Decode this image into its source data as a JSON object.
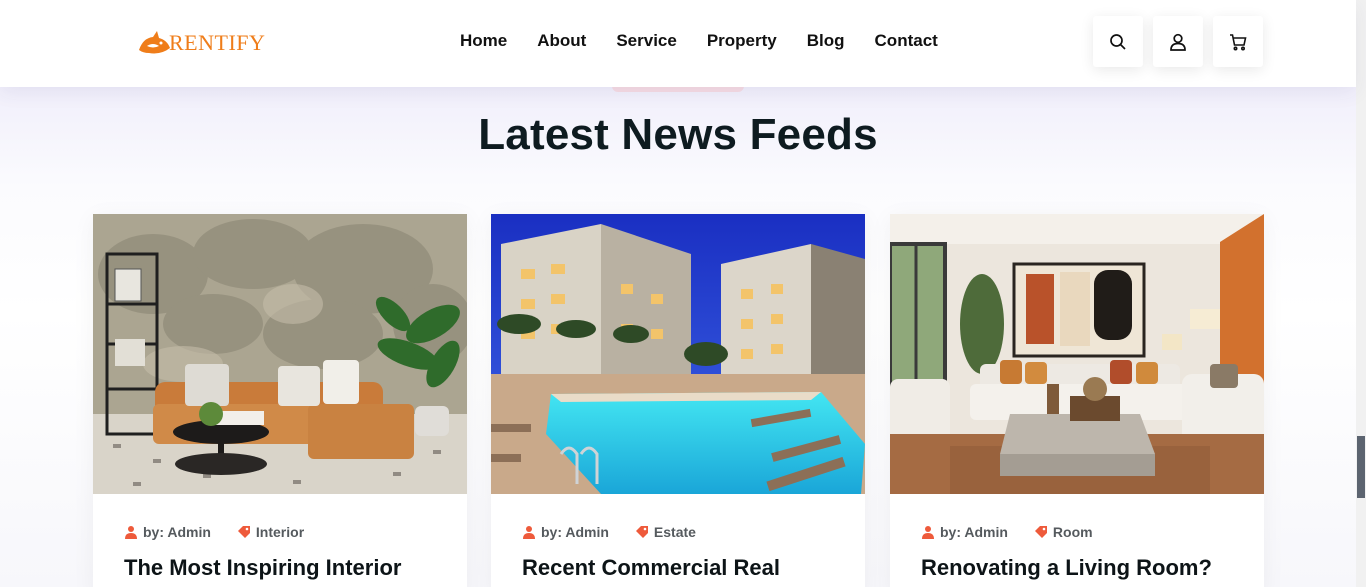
{
  "brand": {
    "name": "RENTIFY",
    "color": "#ef7d1a"
  },
  "nav": {
    "items": [
      {
        "label": "Home"
      },
      {
        "label": "About"
      },
      {
        "label": "Service"
      },
      {
        "label": "Property"
      },
      {
        "label": "Blog"
      },
      {
        "label": "Contact"
      }
    ]
  },
  "header_icons": [
    "search-icon",
    "user-icon",
    "cart-icon"
  ],
  "section": {
    "title": "Latest News Feeds"
  },
  "colors": {
    "accent": "#ee5a3b",
    "heading": "#0e1b20"
  },
  "posts": [
    {
      "author": "by: Admin",
      "category": "Interior",
      "title": "The Most Inspiring Interior",
      "image": "living room with orange sofa and forest mural"
    },
    {
      "author": "by: Admin",
      "category": "Estate",
      "title": "Recent Commercial Real",
      "image": "apartment complex with swimming pool at dusk"
    },
    {
      "author": "by: Admin",
      "category": "Room",
      "title": "Renovating a Living Room?",
      "image": "modern living room with abstract painting"
    }
  ]
}
